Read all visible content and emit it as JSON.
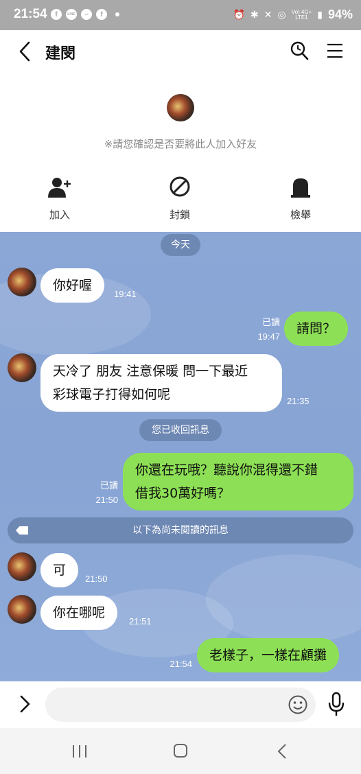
{
  "status_bar": {
    "time": "21:54",
    "battery": "94%",
    "network_top": "Vo) 4G+",
    "network_bottom": "LTE1"
  },
  "header": {
    "title": "建閔"
  },
  "profile": {
    "notice": "※請您確認是否要將此人加入好友",
    "actions": {
      "add": "加入",
      "block": "封鎖",
      "report": "檢舉"
    }
  },
  "chat": {
    "date_label": "今天",
    "messages": [
      {
        "side": "in",
        "text": "你好喔",
        "time": "19:41"
      },
      {
        "side": "out",
        "text": "請問？",
        "time": "19:47",
        "read": "已讀"
      },
      {
        "side": "in",
        "lines": [
          "天冷了 朋友 注意保暖 問一下最近",
          "彩球電子打得如何呢"
        ],
        "time": "21:35"
      },
      {
        "side": "system",
        "text": "您已收回訊息"
      },
      {
        "side": "out",
        "lines": [
          "你還在玩哦？聽說你混得還不錯",
          "借我30萬好嗎？"
        ],
        "time": "21:50",
        "read": "已讀"
      },
      {
        "side": "in",
        "text": "可",
        "time": "21:50"
      },
      {
        "side": "in",
        "text": "你在哪呢",
        "time": "21:51"
      },
      {
        "side": "out",
        "text": "老樣子，一樣在顧攤",
        "time": "21:54"
      }
    ],
    "unread_divider": "以下為尚未閱讀的訊息"
  },
  "input": {
    "placeholder": ""
  },
  "colors": {
    "chat_background": "#8ba7d6",
    "outgoing_bubble": "#8de055",
    "incoming_bubble": "#ffffff",
    "pill": "#6e88b4"
  },
  "icons": [
    "back-arrow-icon",
    "search-icon",
    "menu-icon",
    "add-friend-icon",
    "block-icon",
    "report-icon",
    "tag-icon",
    "expand-icon",
    "emoji-icon",
    "mic-icon"
  ]
}
